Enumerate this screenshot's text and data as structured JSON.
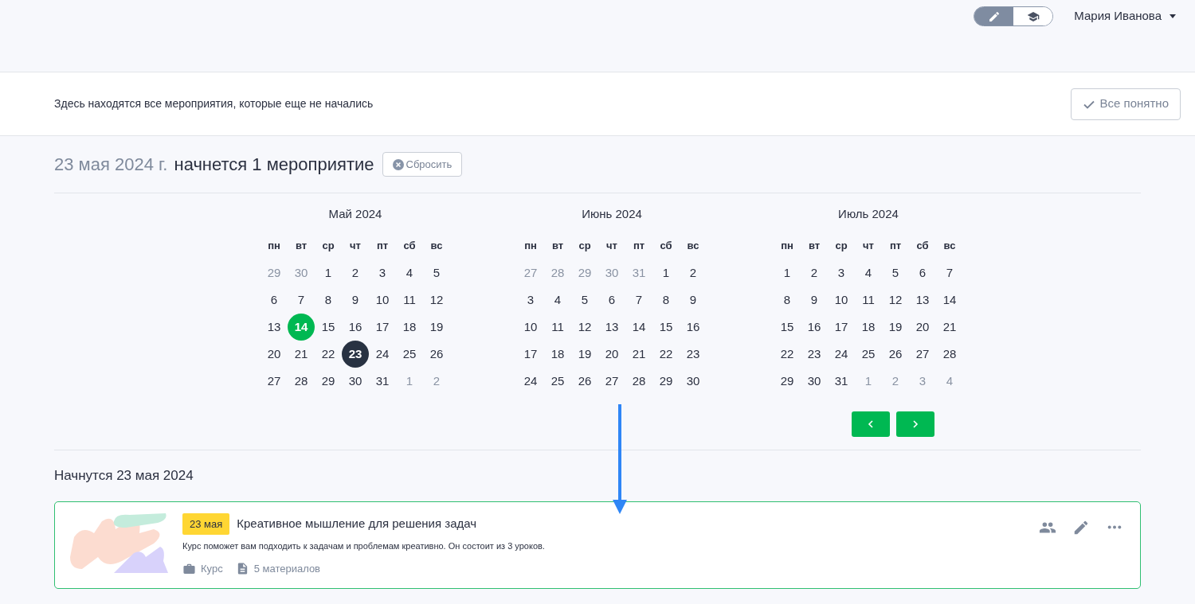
{
  "header": {
    "mode_switch": [
      {
        "kind": "edit",
        "selected": true
      },
      {
        "kind": "student",
        "selected": false
      }
    ],
    "user_name": "Мария Иванова"
  },
  "info_bar": {
    "text": "Здесь находятся все мероприятия, которые еще не начались",
    "button": "Все понятно"
  },
  "summary": {
    "date": "23 мая 2024 г.",
    "text": "начнется 1 мероприятие",
    "reset_button": "Сбросить"
  },
  "calendar": {
    "months": [
      {
        "title": "Май 2024",
        "weekdays": [
          "пн",
          "вт",
          "ср",
          "чт",
          "пт",
          "сб",
          "вс"
        ],
        "weeks": [
          [
            {
              "d": "29",
              "kind": "outside",
              "selected": false
            },
            {
              "d": "30",
              "kind": "outside",
              "selected": false
            },
            {
              "d": "1",
              "kind": "day",
              "selected": false
            },
            {
              "d": "2",
              "kind": "day",
              "selected": false
            },
            {
              "d": "3",
              "kind": "day",
              "selected": false
            },
            {
              "d": "4",
              "kind": "day",
              "selected": false
            },
            {
              "d": "5",
              "kind": "day",
              "selected": false
            }
          ],
          [
            {
              "d": "6",
              "kind": "day",
              "selected": false
            },
            {
              "d": "7",
              "kind": "day",
              "selected": false
            },
            {
              "d": "8",
              "kind": "day",
              "selected": false
            },
            {
              "d": "9",
              "kind": "day",
              "selected": false
            },
            {
              "d": "10",
              "kind": "day",
              "selected": false
            },
            {
              "d": "11",
              "kind": "day",
              "selected": false
            },
            {
              "d": "12",
              "kind": "day",
              "selected": false
            }
          ],
          [
            {
              "d": "13",
              "kind": "day",
              "selected": false
            },
            {
              "d": "14",
              "kind": "today",
              "selected": false
            },
            {
              "d": "15",
              "kind": "day",
              "selected": false
            },
            {
              "d": "16",
              "kind": "day",
              "selected": false
            },
            {
              "d": "17",
              "kind": "day",
              "selected": false
            },
            {
              "d": "18",
              "kind": "day",
              "selected": false
            },
            {
              "d": "19",
              "kind": "day",
              "selected": false
            }
          ],
          [
            {
              "d": "20",
              "kind": "day",
              "selected": false
            },
            {
              "d": "21",
              "kind": "day",
              "selected": false
            },
            {
              "d": "22",
              "kind": "day",
              "selected": false
            },
            {
              "d": "23",
              "kind": "day",
              "selected": true
            },
            {
              "d": "24",
              "kind": "day",
              "selected": false
            },
            {
              "d": "25",
              "kind": "day",
              "selected": false
            },
            {
              "d": "26",
              "kind": "day",
              "selected": false
            }
          ],
          [
            {
              "d": "27",
              "kind": "day",
              "selected": false
            },
            {
              "d": "28",
              "kind": "day",
              "selected": false
            },
            {
              "d": "29",
              "kind": "day",
              "selected": false
            },
            {
              "d": "30",
              "kind": "day",
              "selected": false
            },
            {
              "d": "31",
              "kind": "day",
              "selected": false
            },
            {
              "d": "1",
              "kind": "outside",
              "selected": false
            },
            {
              "d": "2",
              "kind": "outside",
              "selected": false
            }
          ]
        ]
      },
      {
        "title": "Июнь 2024",
        "weekdays": [
          "пн",
          "вт",
          "ср",
          "чт",
          "пт",
          "сб",
          "вс"
        ],
        "weeks": [
          [
            {
              "d": "27",
              "kind": "outside",
              "selected": false
            },
            {
              "d": "28",
              "kind": "outside",
              "selected": false
            },
            {
              "d": "29",
              "kind": "outside",
              "selected": false
            },
            {
              "d": "30",
              "kind": "outside",
              "selected": false
            },
            {
              "d": "31",
              "kind": "outside",
              "selected": false
            },
            {
              "d": "1",
              "kind": "day",
              "selected": false
            },
            {
              "d": "2",
              "kind": "day",
              "selected": false
            }
          ],
          [
            {
              "d": "3",
              "kind": "day",
              "selected": false
            },
            {
              "d": "4",
              "kind": "day",
              "selected": false
            },
            {
              "d": "5",
              "kind": "day",
              "selected": false
            },
            {
              "d": "6",
              "kind": "day",
              "selected": false
            },
            {
              "d": "7",
              "kind": "day",
              "selected": false
            },
            {
              "d": "8",
              "kind": "day",
              "selected": false
            },
            {
              "d": "9",
              "kind": "day",
              "selected": false
            }
          ],
          [
            {
              "d": "10",
              "kind": "day",
              "selected": false
            },
            {
              "d": "11",
              "kind": "day",
              "selected": false
            },
            {
              "d": "12",
              "kind": "day",
              "selected": false
            },
            {
              "d": "13",
              "kind": "day",
              "selected": false
            },
            {
              "d": "14",
              "kind": "day",
              "selected": false
            },
            {
              "d": "15",
              "kind": "day",
              "selected": false
            },
            {
              "d": "16",
              "kind": "day",
              "selected": false
            }
          ],
          [
            {
              "d": "17",
              "kind": "day",
              "selected": false
            },
            {
              "d": "18",
              "kind": "day",
              "selected": false
            },
            {
              "d": "19",
              "kind": "day",
              "selected": false
            },
            {
              "d": "20",
              "kind": "day",
              "selected": false
            },
            {
              "d": "21",
              "kind": "day",
              "selected": false
            },
            {
              "d": "22",
              "kind": "day",
              "selected": false
            },
            {
              "d": "23",
              "kind": "day",
              "selected": false
            }
          ],
          [
            {
              "d": "24",
              "kind": "day",
              "selected": false
            },
            {
              "d": "25",
              "kind": "day",
              "selected": false
            },
            {
              "d": "26",
              "kind": "day",
              "selected": false
            },
            {
              "d": "27",
              "kind": "day",
              "selected": false
            },
            {
              "d": "28",
              "kind": "day",
              "selected": false
            },
            {
              "d": "29",
              "kind": "day",
              "selected": false
            },
            {
              "d": "30",
              "kind": "day",
              "selected": false
            }
          ]
        ]
      },
      {
        "title": "Июль 2024",
        "weekdays": [
          "пн",
          "вт",
          "ср",
          "чт",
          "пт",
          "сб",
          "вс"
        ],
        "weeks": [
          [
            {
              "d": "1",
              "kind": "day",
              "selected": false
            },
            {
              "d": "2",
              "kind": "day",
              "selected": false
            },
            {
              "d": "3",
              "kind": "day",
              "selected": false
            },
            {
              "d": "4",
              "kind": "day",
              "selected": false
            },
            {
              "d": "5",
              "kind": "day",
              "selected": false
            },
            {
              "d": "6",
              "kind": "day",
              "selected": false
            },
            {
              "d": "7",
              "kind": "day",
              "selected": false
            }
          ],
          [
            {
              "d": "8",
              "kind": "day",
              "selected": false
            },
            {
              "d": "9",
              "kind": "day",
              "selected": false
            },
            {
              "d": "10",
              "kind": "day",
              "selected": false
            },
            {
              "d": "11",
              "kind": "day",
              "selected": false
            },
            {
              "d": "12",
              "kind": "day",
              "selected": false
            },
            {
              "d": "13",
              "kind": "day",
              "selected": false
            },
            {
              "d": "14",
              "kind": "day",
              "selected": false
            }
          ],
          [
            {
              "d": "15",
              "kind": "day",
              "selected": false
            },
            {
              "d": "16",
              "kind": "day",
              "selected": false
            },
            {
              "d": "17",
              "kind": "day",
              "selected": false
            },
            {
              "d": "18",
              "kind": "day",
              "selected": false
            },
            {
              "d": "19",
              "kind": "day",
              "selected": false
            },
            {
              "d": "20",
              "kind": "day",
              "selected": false
            },
            {
              "d": "21",
              "kind": "day",
              "selected": false
            }
          ],
          [
            {
              "d": "22",
              "kind": "day",
              "selected": false
            },
            {
              "d": "23",
              "kind": "day",
              "selected": false
            },
            {
              "d": "24",
              "kind": "day",
              "selected": false
            },
            {
              "d": "25",
              "kind": "day",
              "selected": false
            },
            {
              "d": "26",
              "kind": "day",
              "selected": false
            },
            {
              "d": "27",
              "kind": "day",
              "selected": false
            },
            {
              "d": "28",
              "kind": "day",
              "selected": false
            }
          ],
          [
            {
              "d": "29",
              "kind": "day",
              "selected": false
            },
            {
              "d": "30",
              "kind": "day",
              "selected": false
            },
            {
              "d": "31",
              "kind": "day",
              "selected": false
            },
            {
              "d": "1",
              "kind": "outside",
              "selected": false
            },
            {
              "d": "2",
              "kind": "outside",
              "selected": false
            },
            {
              "d": "3",
              "kind": "outside",
              "selected": false
            },
            {
              "d": "4",
              "kind": "outside",
              "selected": false
            }
          ]
        ]
      }
    ]
  },
  "events_section": {
    "title": "Начнутся 23 мая 2024",
    "events": [
      {
        "date_badge": "23 мая",
        "title": "Креативное мышление для решения задач",
        "description": "Курс поможет вам подходить к задачам и проблемам креативно. Он состоит из 3 уроков.",
        "type": "Курс",
        "materials": "5 материалов"
      }
    ]
  }
}
